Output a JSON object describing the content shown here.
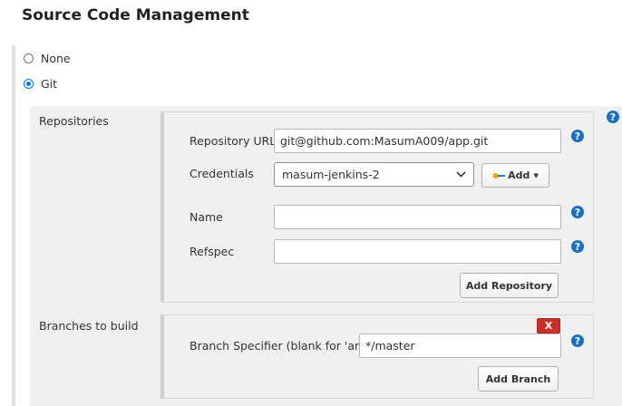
{
  "section": {
    "title": "Source Code Management"
  },
  "scm_options": [
    {
      "label": "None",
      "selected": false
    },
    {
      "label": "Git",
      "selected": true
    }
  ],
  "repositories": {
    "label": "Repositories",
    "url_label": "Repository URL",
    "url_value": "git@github.com:MasumA009/app.git",
    "credentials_label": "Credentials",
    "credentials_selected": "masum-jenkins-2",
    "add_label": "Add",
    "name_label": "Name",
    "name_value": "",
    "refspec_label": "Refspec",
    "refspec_value": "",
    "add_repository_label": "Add Repository"
  },
  "branches": {
    "label": "Branches to build",
    "delete_label": "X",
    "specifier_label": "Branch Specifier (blank for 'any')",
    "specifier_value": "*/master",
    "add_branch_label": "Add Branch"
  },
  "help_glyph": "?",
  "icons": [
    "help-icon",
    "key-icon",
    "caret-down-icon",
    "chevron-down-icon"
  ],
  "colors": {
    "help_blue": "#1a6fc2",
    "delete_red": "#c9302c",
    "radio_blue": "#0075ff"
  }
}
